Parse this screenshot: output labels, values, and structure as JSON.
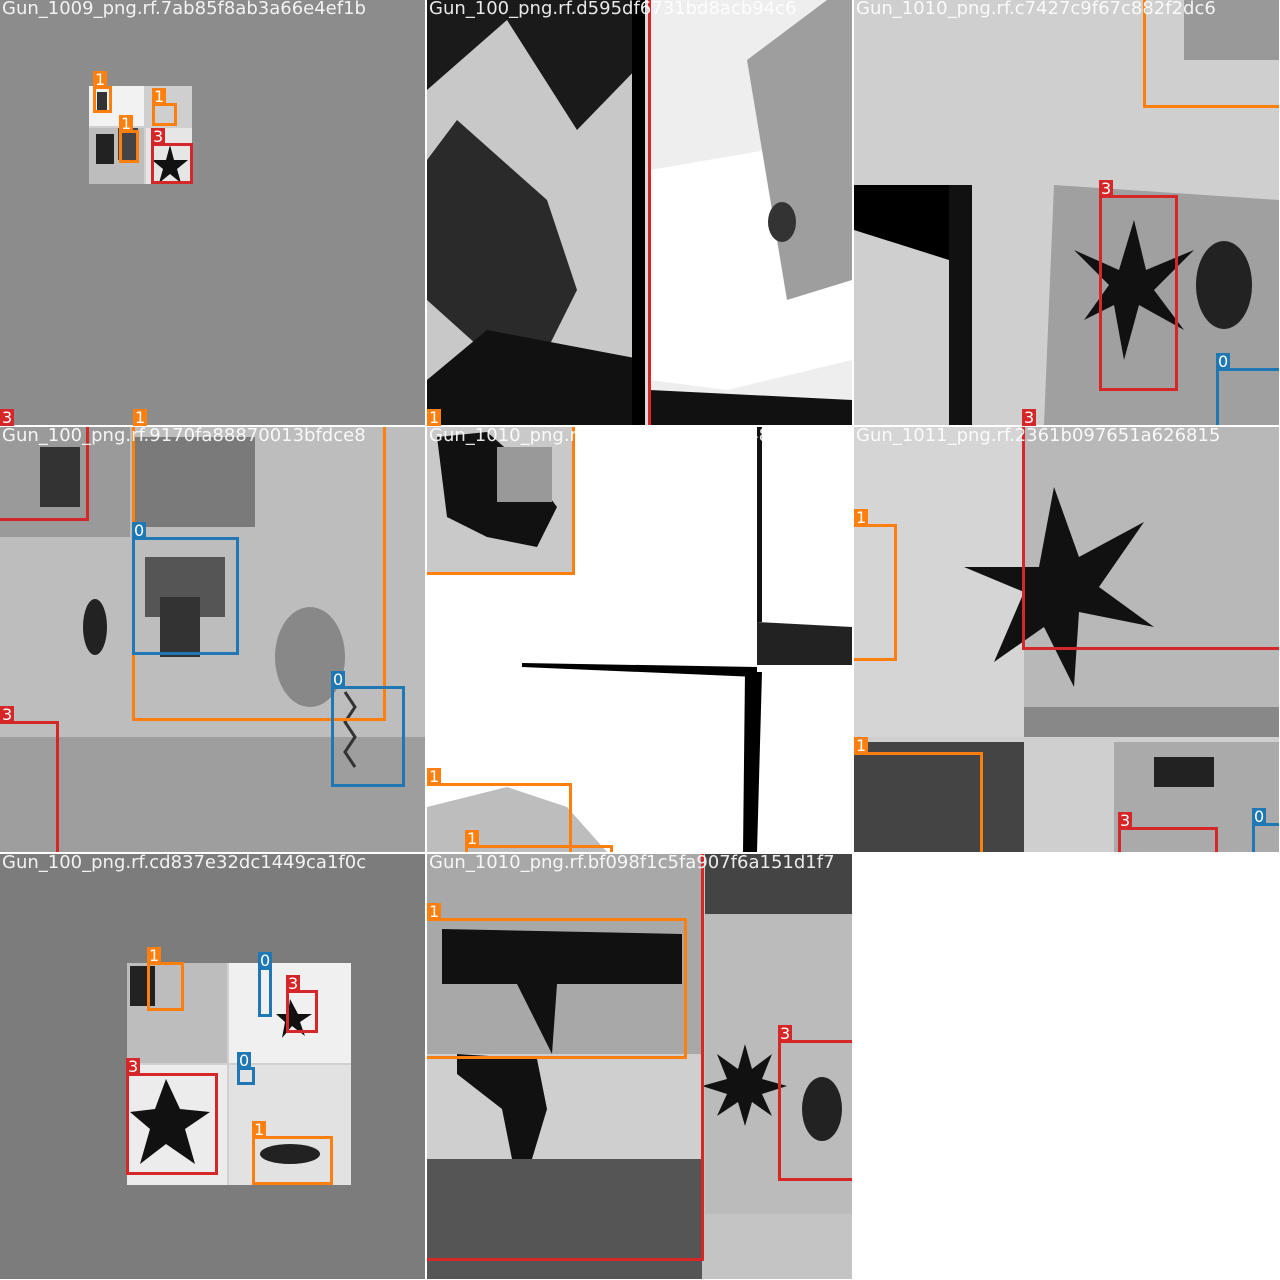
{
  "class_colors": {
    "0": "#1f77b4",
    "1": "#ff7f0e",
    "3": "#d62728"
  },
  "tiles": [
    {
      "filename": "Gun_1009_png.rf.7ab85f8ab3a66e4ef1b",
      "bg": "#8c8c8c",
      "boxes": [
        {
          "cls": "1"
        },
        {
          "cls": "1"
        },
        {
          "cls": "1"
        },
        {
          "cls": "3"
        }
      ]
    },
    {
      "filename": "Gun_100_png.rf.d595df6731bd8acb94c6",
      "bg": "#d8d8d8",
      "boxes": []
    },
    {
      "filename": "Gun_1010_png.rf.c7427c9f67c882f2dc6",
      "bg": "#cfcfcf",
      "boxes": [
        {
          "cls": "1"
        },
        {
          "cls": "3"
        },
        {
          "cls": "0"
        }
      ]
    },
    {
      "filename": "Gun_100_png.rf.9170fa88870013bfdce8",
      "bg": "#b5b5b5",
      "boxes": [
        {
          "cls": "3"
        },
        {
          "cls": "1"
        },
        {
          "cls": "0"
        },
        {
          "cls": "0"
        },
        {
          "cls": "3"
        }
      ]
    },
    {
      "filename": "Gun_1010_png.rf.789071e1a5d44048fe9",
      "bg": "#ffffff",
      "boxes": [
        {
          "cls": "1"
        },
        {
          "cls": "1"
        },
        {
          "cls": "1"
        }
      ]
    },
    {
      "filename": "Gun_1011_png.rf.2361b097651a626815",
      "bg": "#cfcfcf",
      "boxes": [
        {
          "cls": "3"
        },
        {
          "cls": "1"
        },
        {
          "cls": "1"
        },
        {
          "cls": "3"
        },
        {
          "cls": "0"
        }
      ]
    },
    {
      "filename": "Gun_100_png.rf.cd837e32dc1449ca1f0c",
      "bg": "#7c7c7c",
      "boxes": [
        {
          "cls": "1"
        },
        {
          "cls": "0"
        },
        {
          "cls": "3"
        },
        {
          "cls": "3"
        },
        {
          "cls": "0"
        },
        {
          "cls": "1"
        }
      ]
    },
    {
      "filename": "Gun_1010_png.rf.bf098f1c5fa907f6a151d1f7",
      "bg": "#c4c4c4",
      "boxes": [
        {
          "cls": "1"
        },
        {
          "cls": "3"
        },
        {
          "cls": "3"
        }
      ]
    }
  ],
  "edge_labels": [
    {
      "cls": "3"
    },
    {
      "cls": "1"
    },
    {
      "cls": "1"
    },
    {
      "cls": "3"
    }
  ]
}
